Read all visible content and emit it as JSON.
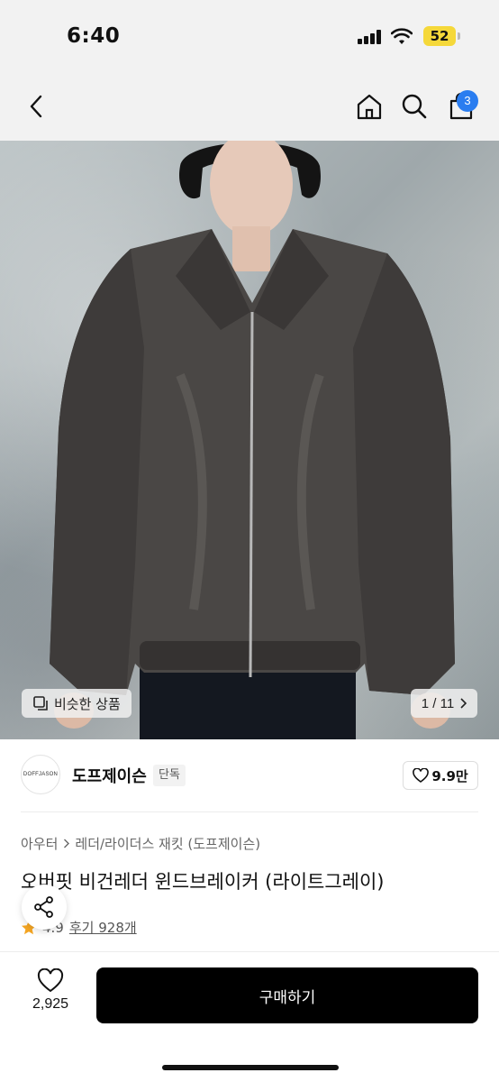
{
  "status_bar": {
    "time": "6:40",
    "battery": "52"
  },
  "header": {
    "cart_count": "3"
  },
  "gallery": {
    "similar_label": "비슷한 상품",
    "page": "1 / 11"
  },
  "brand": {
    "logo_text": "DOFFJASON",
    "name": "도프제이슨",
    "badge": "단독",
    "likes": "9.9만"
  },
  "product": {
    "breadcrumb": [
      "아우터",
      "레더/라이더스 재킷 (도프제이슨)"
    ],
    "title": "오버핏 비건레더 윈드브레이커 (라이트그레이)",
    "rating": "4.9",
    "reviews": "후기 928개"
  },
  "bottom": {
    "like_count": "2,925",
    "buy_label": "구매하기"
  },
  "colors": {
    "accent": "#2a7df0",
    "rating_star": "#f5a623",
    "buy_button": "#000000"
  }
}
